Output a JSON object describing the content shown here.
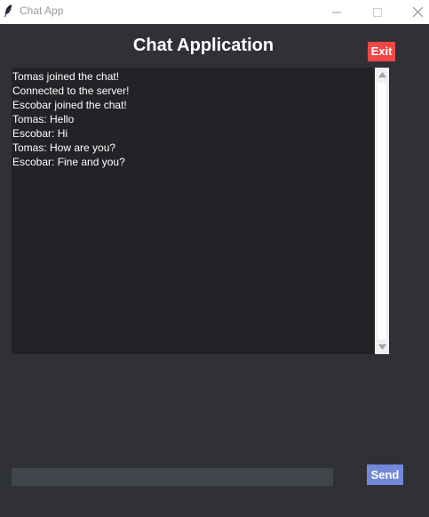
{
  "window": {
    "title": "Chat App",
    "icon": "feather-icon"
  },
  "header": {
    "title": "Chat Application",
    "exit_label": "Exit"
  },
  "chat": {
    "messages": [
      "Tomas joined the chat!",
      "Connected to the server!",
      "Escobar joined the chat!",
      "Tomas: Hello",
      "Escobar: Hi",
      "Tomas: How are you?",
      "Escobar: Fine and you?"
    ]
  },
  "composer": {
    "input_value": "",
    "send_label": "Send"
  },
  "colors": {
    "background": "#2f3136",
    "chat_background": "#212326",
    "exit_button": "#f04747",
    "send_button": "#7289da",
    "input_background": "#40444b"
  }
}
